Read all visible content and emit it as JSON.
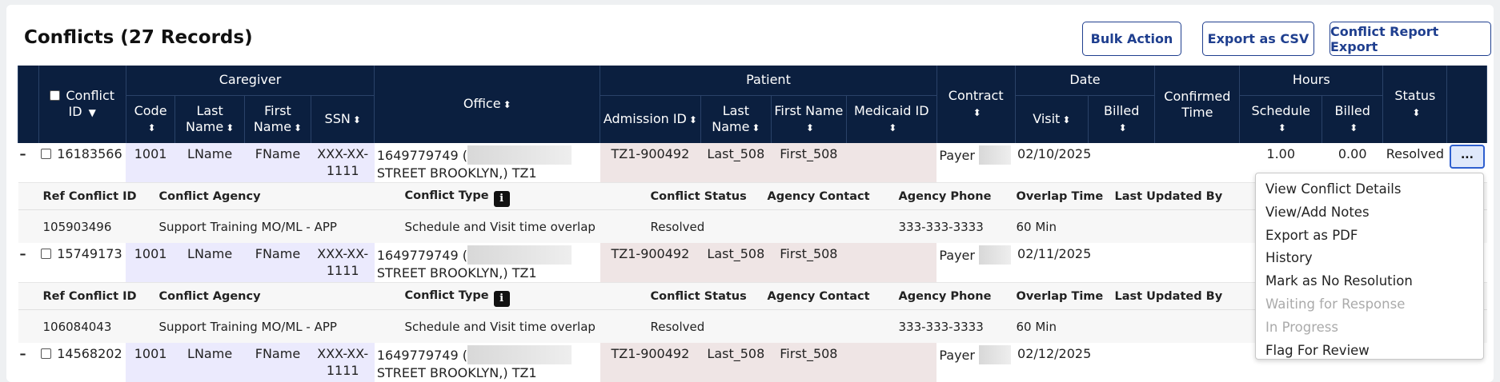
{
  "page": {
    "title": "Conflicts (27 Records)",
    "buttons": {
      "bulk_action": "Bulk Action",
      "export_csv": "Export as CSV",
      "conflict_report_export": "Conflict Report Export"
    }
  },
  "table": {
    "group_headers": {
      "caregiver": "Caregiver",
      "patient": "Patient",
      "date": "Date",
      "hours": "Hours"
    },
    "headers": {
      "conflict_id": "Conflict ID",
      "code": "Code",
      "cg_last": "Last Name",
      "cg_first": "First Name",
      "ssn": "SSN",
      "office": "Office",
      "admission_id": "Admission ID",
      "pt_last": "Last Name",
      "pt_first": "First Name",
      "medicaid_id": "Medicaid ID",
      "contract": "Contract",
      "visit": "Visit",
      "billed": "Billed",
      "confirmed_time": "Confirmed Time",
      "schedule": "Schedule",
      "hours_billed": "Billed",
      "status": "Status"
    },
    "sub_headers": {
      "ref_conflict_id": "Ref Conflict ID",
      "conflict_agency": "Conflict Agency",
      "conflict_type": "Conflict Type",
      "conflict_status": "Conflict Status",
      "agency_contact": "Agency Contact",
      "agency_phone": "Agency Phone",
      "overlap_time": "Overlap Time",
      "last_updated_by": "Last Updated By"
    },
    "rows": [
      {
        "conflict_id": "16183566",
        "code": "1001",
        "cg_last": "LName",
        "cg_first": "FName",
        "ssn": "XXX-XX-1111",
        "office_a": "1649779749 (",
        "office_b": "STREET BROOKLYN,) TZ1",
        "admission_id": "TZ1-900492",
        "pt_last": "Last_508",
        "pt_first": "First_508",
        "contract": "Payer",
        "visit": "02/10/2025",
        "schedule": "1.00",
        "hours_billed": "0.00",
        "status": "Resolved",
        "detail": {
          "ref_conflict_id": "105903496",
          "conflict_agency": "Support Training MO/ML - APP",
          "conflict_type": "Schedule and Visit time overlap",
          "conflict_status": "Resolved",
          "agency_contact": "",
          "agency_phone": "333-333-3333",
          "overlap_time": "60 Min",
          "last_updated_by": ""
        }
      },
      {
        "conflict_id": "15749173",
        "code": "1001",
        "cg_last": "LName",
        "cg_first": "FName",
        "ssn": "XXX-XX-1111",
        "office_a": "1649779749 (",
        "office_b": "STREET BROOKLYN,) TZ1",
        "admission_id": "TZ1-900492",
        "pt_last": "Last_508",
        "pt_first": "First_508",
        "contract": "Payer",
        "visit": "02/11/2025",
        "schedule": "",
        "hours_billed": "",
        "status": "",
        "detail": {
          "ref_conflict_id": "106084043",
          "conflict_agency": "Support Training MO/ML - APP",
          "conflict_type": "Schedule and Visit time overlap",
          "conflict_status": "Resolved",
          "agency_contact": "",
          "agency_phone": "333-333-3333",
          "overlap_time": "60 Min",
          "last_updated_by": ""
        }
      },
      {
        "conflict_id": "14568202",
        "code": "1001",
        "cg_last": "LName",
        "cg_first": "FName",
        "ssn": "XXX-XX-1111",
        "office_a": "1649779749 (",
        "office_b": "STREET BROOKLYN,) TZ1",
        "admission_id": "TZ1-900492",
        "pt_last": "Last_508",
        "pt_first": "First_508",
        "contract": "Payer",
        "visit": "02/12/2025"
      }
    ]
  },
  "row_menu": {
    "button_label": "...",
    "items": [
      {
        "label": "View Conflict Details",
        "enabled": true
      },
      {
        "label": "View/Add Notes",
        "enabled": true
      },
      {
        "label": "Export as PDF",
        "enabled": true
      },
      {
        "label": "History",
        "enabled": true
      },
      {
        "label": "Mark as No Resolution",
        "enabled": true
      },
      {
        "label": "Waiting for Response",
        "enabled": false
      },
      {
        "label": "In Progress",
        "enabled": false
      },
      {
        "label": "Flag For Review",
        "enabled": true
      }
    ]
  },
  "icons": {
    "expand": "minus-icon",
    "sort": "sort-arrows-icon",
    "sort_desc": "sort-down-icon",
    "info": "info-icon"
  },
  "colors": {
    "header_bg": "#0b1f3f",
    "accent": "#1f3f8f",
    "caregiver_cell_bg": "#ebeafd",
    "patient_cell_bg": "#efe5e5"
  }
}
